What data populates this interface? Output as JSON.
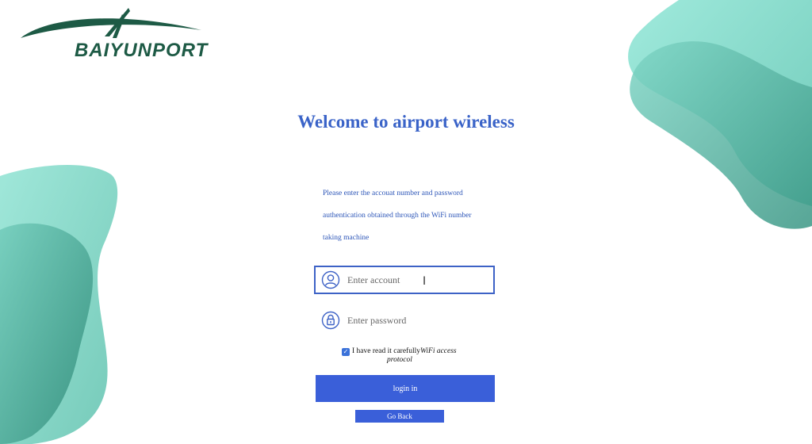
{
  "logo": {
    "text": "BAIYUNPORT"
  },
  "title": "Welcome to airport wireless",
  "intro": [
    "Please enter the accouat number and password",
    "authentication obtained through the  WiFi number",
    "taking machine"
  ],
  "account": {
    "placeholder": "Enter account",
    "icon": "user-icon"
  },
  "password": {
    "placeholder": "Enter password",
    "icon": "lock-icon"
  },
  "agreement": {
    "checked": true,
    "text": "I have read it carefully",
    "link_part1": "WiFi access",
    "link_part2": "protocol"
  },
  "buttons": {
    "login": "login in",
    "back": "Go Back"
  },
  "colors": {
    "accent": "#3a5fd9",
    "title": "#3a63c8",
    "logo": "#1d5a45",
    "teal_light": "#7fdccc",
    "teal_dark": "#3f9e8c"
  }
}
